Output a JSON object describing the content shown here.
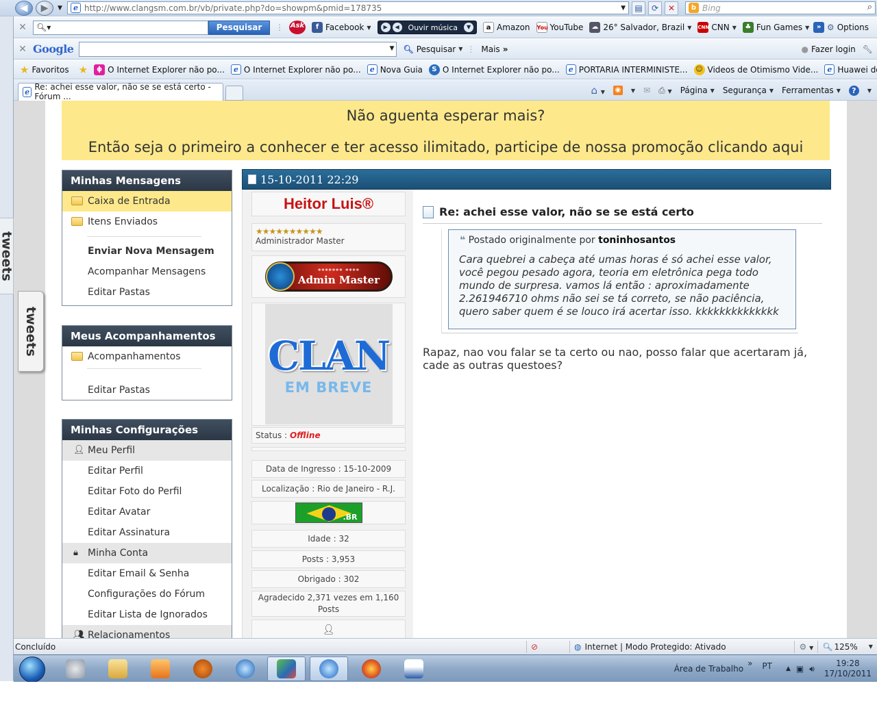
{
  "browser": {
    "url": "http://www.clangsm.com.br/vb/private.php?do=showpm&pmid=178735",
    "search_placeholder": "Bing",
    "ask_search_button": "Pesquisar",
    "toolbar": {
      "facebook": "Facebook",
      "ouvir_musica": "Ouvir música",
      "amazon": "Amazon",
      "youtube": "YouTube",
      "weather": "26° Salvador, Brazil",
      "cnn": "CNN",
      "fun_games": "Fun Games",
      "options": "Options"
    },
    "google": {
      "logo": "Google",
      "pesquisar": "Pesquisar",
      "mais": "Mais",
      "fazer_login": "Fazer login"
    },
    "favorites": {
      "label": "Favoritos",
      "items": [
        "O Internet Explorer não po...",
        "O Internet Explorer não po...",
        "Nova Guia",
        "O Internet Explorer não po...",
        "PORTARIA INTERMINISTE...",
        "Videos de Otimismo  Vide...",
        "Huawei do Brasil"
      ]
    },
    "tab_title": "Re: achei esse valor, não se se está certo - Fórum ...",
    "command_bar": {
      "pagina": "Página",
      "seguranca": "Segurança",
      "ferramentas": "Ferramentas"
    }
  },
  "left_widget": {
    "tweets_a": "tweets",
    "tweets_b": "tweets"
  },
  "promo": {
    "line1": "Não aguenta esperar mais?",
    "line2": "Então seja o primeiro a conhecer e ter acesso ilimitado, participe de nossa promoção clicando aqui"
  },
  "sidebar": {
    "mensagens": {
      "title": "Minhas Mensagens",
      "items": [
        "Caixa de Entrada",
        "Itens Enviados",
        "Enviar Nova Mensagem",
        "Acompanhar Mensagens",
        "Editar Pastas"
      ]
    },
    "acompanhamentos": {
      "title": "Meus Acompanhamentos",
      "items": [
        "Acompanhamentos",
        "Editar Pastas"
      ]
    },
    "configuracoes": {
      "title": "Minhas Configurações",
      "items": [
        "Meu Perfil",
        "Editar Perfil",
        "Editar Foto do Perfil",
        "Editar Avatar",
        "Editar Assinatura",
        "Minha Conta",
        "Editar Email & Senha",
        "Configurações do Fórum",
        "Editar Lista de Ignorados",
        "Relacionamentos"
      ]
    }
  },
  "post": {
    "date": "15-10-2011 22:29",
    "user": {
      "name": "Heitor Luis®",
      "rank": "Administrador Master",
      "badge_dots": "*******  ****",
      "badge_text": "Admin Master",
      "avatar_line1": "CLAN",
      "avatar_line2": "EM BREVE",
      "status_label": "Status :",
      "status_value": "Offline",
      "ingresso": "Data de Ingresso : 15-10-2009",
      "localizacao": "Localização : Rio de Janeiro - R.J.",
      "flag_text": ".BR",
      "idade": "Idade : 32",
      "posts": "Posts : 3,953",
      "obrigado": "Obrigado : 302",
      "agradecido": "Agradecido 2,371 vezes em 1,160 Posts"
    },
    "title": "Re: achei esse valor, não se se está certo",
    "quote": {
      "by_prefix": "Postado originalmente por",
      "author": "toninhosantos",
      "text": "Cara quebrei a cabeça até umas horas é só achei esse valor, você pegou pesado agora, teoria em eletrônica pega todo mundo de surpresa. vamos lá então : aproximadamente 2.261946710 ohms não sei se tá correto, se não paciência, quero saber quem é se louco irá acertar isso. kkkkkkkkkkkkkk"
    },
    "reply": "Rapaz, nao vou falar se ta certo ou nao, posso falar que acertaram já, cade as outras questoes?"
  },
  "statusbar": {
    "left": "Concluído",
    "zone": "Internet | Modo Protegido: Ativado",
    "zoom": "125%"
  },
  "taskbar": {
    "desktop": "Área de Trabalho",
    "lang": "PT",
    "time": "19:28",
    "date": "17/10/2011"
  }
}
